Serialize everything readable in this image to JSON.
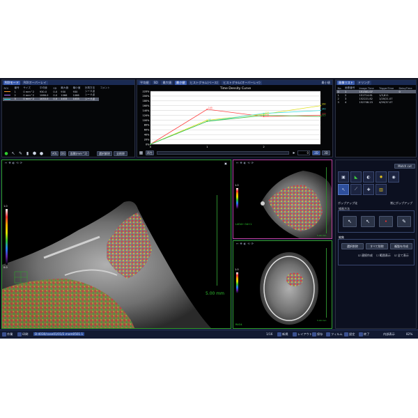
{
  "roi_panel": {
    "tabs": [
      "ROIモード",
      "ROIオーバーレイ"
    ],
    "table": {
      "headers": [
        "ROI",
        "番号",
        "サイズ",
        "平均値",
        "SD",
        "最大値",
        "最小値",
        "計測方法",
        "コメント"
      ],
      "rows": [
        [
          "1",
          "0 mm^2",
          "930.0",
          "0.0",
          "930",
          "930",
          "シード点"
        ],
        [
          "2",
          "0 mm^2",
          "1066.0",
          "0.0",
          "1066",
          "1066",
          "シード点"
        ],
        [
          "3",
          "0 mm^2",
          "1033.0",
          "0.0",
          "1033",
          "1033",
          "シード点"
        ]
      ],
      "row_colors": [
        "#ff9a2a",
        "#b070ff",
        "#30e0e0"
      ],
      "selected_row": 2
    },
    "toolbar": {
      "vol_label": "VOL",
      "dg_label": "DG",
      "area_label": "面積(mm^2)",
      "select_all_label": "選択解除",
      "delete_all_label": "全削除"
    }
  },
  "curve_panel": {
    "tabs": [
      "平均値",
      "SD",
      "最大値",
      "最小値",
      "ヒストグラム(ベース)",
      "ヒストグラム(オーバーレイ)"
    ],
    "active_tab": 3,
    "right_tab": "最小値",
    "chart_data": {
      "type": "line",
      "title": "Time Density Curve",
      "yticks": [
        "220%",
        "200%",
        "180%",
        "160%",
        "140%",
        "120%",
        "100%",
        "80%",
        "60%",
        "40%",
        "20%",
        "0%"
      ],
      "xticks": [
        "0",
        "1",
        "2"
      ],
      "ylim": [
        0,
        220
      ],
      "x": [
        0,
        1,
        2,
        3
      ],
      "series": [
        {
          "values": [
            0,
            145,
            115,
            120
          ],
          "color": "#ff4040"
        },
        {
          "values": [
            0,
            100,
            125,
            160
          ],
          "color": "#e0e020"
        },
        {
          "values": [
            0,
            95,
            128,
            140
          ],
          "color": "#40e0e0"
        },
        {
          "values": [
            0,
            95,
            120,
            115
          ],
          "color": "#40c040"
        }
      ],
      "labels": [
        {
          "x": 1,
          "y": 145,
          "text": "145",
          "color": "#ff4040"
        },
        {
          "x": 1,
          "y": 95,
          "text": "95",
          "color": "#40e0e0"
        },
        {
          "x": 2,
          "y": 125,
          "text": "125",
          "color": "#e0e020"
        },
        {
          "x": 2,
          "y": 115,
          "text": "115",
          "color": "#ff4040"
        },
        {
          "x": 3,
          "y": 160,
          "text": "160",
          "color": "#e0e020"
        },
        {
          "x": 3,
          "y": 140,
          "text": "140",
          "color": "#40e0e0"
        },
        {
          "x": 3,
          "y": 120,
          "text": "120",
          "color": "#ff4040"
        },
        {
          "x": 3,
          "y": 115,
          "text": "115",
          "color": "#40c040"
        }
      ]
    },
    "playback": {
      "play_label": "再生",
      "frame_value": "0",
      "mode_2d": "2D",
      "mode_3d": "3D"
    }
  },
  "series_panel": {
    "tabs": [
      "画像リスト",
      "ドリング"
    ],
    "headers": [
      "No.",
      "画像番号",
      "Image Time",
      "TriggerTime",
      "DelayTime"
    ],
    "rows": [
      [
        "0",
        "1",
        "151301.07",
        "",
        "0"
      ],
      [
        "1",
        "2",
        "151714.61",
        "1/3,811",
        ""
      ],
      [
        "2",
        "3",
        "152221.82",
        "1/20/21.07",
        ""
      ],
      [
        "3",
        "4",
        "152708.23",
        "4/59/37.07",
        ""
      ]
    ],
    "selected_row": 0
  },
  "tool_panel": {
    "match_cut_label": "Match cut",
    "popup_label": "ポップアップ化",
    "no_popup_label": "常にポップアップ",
    "draw_method_title": "描画方法",
    "edit_title": "編集",
    "select_delete_label": "選択削除",
    "delete_all_label": "すべて削除",
    "copy_make_label": "複製を作成",
    "check_continuous": "連続作成",
    "check_range": "範囲表示",
    "check_all_display": "全て表示"
  },
  "viewports": {
    "main": {
      "scale_label": "5.00 mm",
      "colorbar_top": "1.0",
      "colorbar_bottom": "0.0"
    },
    "top_right": {
      "marker_label": "L4O4+ O4+1",
      "scale_label": "5.00 mm",
      "colorbar_top": "1.0"
    },
    "bottom_right": {
      "marker_label": "R4O4",
      "scale_label": "5.00 mm",
      "colorbar_top": "1.0"
    },
    "tool_icons": [
      "↔",
      "✥",
      "◐",
      "⟲",
      "⟳"
    ]
  },
  "statusbar": {
    "file_label": "作業",
    "print_label": "印刷",
    "path_text": "D:4030/case01/01/2.mam0501.1",
    "page_label": "1/16",
    "new_label": "新規",
    "layout_label": "レイアウト",
    "save_label": "保存",
    "filmset_label": "フィルム",
    "settings_label": "設定",
    "exit_label": "終了",
    "date_label": "内部表示",
    "zoom_label": "82%"
  },
  "colors": {
    "accent": "#2e4f9c",
    "background": "#0c1020",
    "grid": "#4a4a4a",
    "green_ruler": "#2c8a2c"
  }
}
